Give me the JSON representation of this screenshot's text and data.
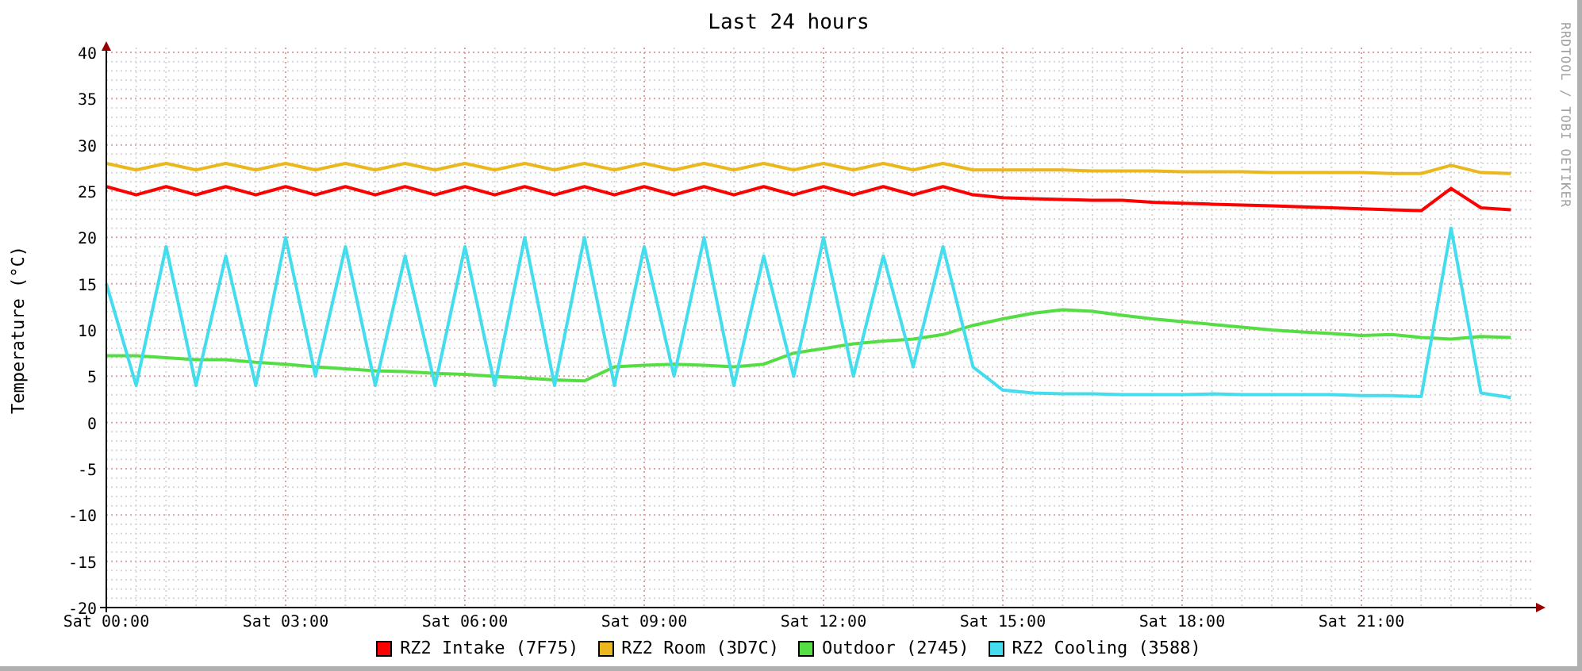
{
  "credit": "RRDTOOL / TOBI OETIKER",
  "chart_data": {
    "type": "line",
    "title": "Last 24 hours",
    "ylabel": "Temperature (°C)",
    "grid": true,
    "ylim": [
      -20,
      40
    ],
    "yticks": [
      -20,
      -15,
      -10,
      -5,
      0,
      5,
      10,
      15,
      20,
      25,
      30,
      35,
      40
    ],
    "categories": [
      "Sat 00:00",
      null,
      null,
      null,
      null,
      null,
      "Sat 03:00",
      null,
      null,
      null,
      null,
      null,
      "Sat 06:00",
      null,
      null,
      null,
      null,
      null,
      "Sat 09:00",
      null,
      null,
      null,
      null,
      null,
      "Sat 12:00",
      null,
      null,
      null,
      null,
      null,
      "Sat 15:00",
      null,
      null,
      null,
      null,
      null,
      "Sat 18:00",
      null,
      null,
      null,
      null,
      null,
      "Sat 21:00",
      null,
      null,
      null,
      null,
      null
    ],
    "series": [
      {
        "name": "RZ2 Intake (7F75)",
        "color": "#ff0000",
        "values": [
          25.5,
          24.6,
          25.5,
          24.6,
          25.5,
          24.6,
          25.5,
          24.6,
          25.5,
          24.6,
          25.5,
          24.6,
          25.5,
          24.6,
          25.5,
          24.6,
          25.5,
          24.6,
          25.5,
          24.6,
          25.5,
          24.6,
          25.5,
          24.6,
          25.5,
          24.6,
          25.5,
          24.6,
          25.5,
          24.6,
          24.3,
          24.2,
          24.1,
          24.0,
          24.0,
          23.8,
          23.7,
          23.6,
          23.5,
          23.4,
          23.3,
          23.2,
          23.1,
          23.0,
          22.9,
          25.3,
          23.2,
          23.0
        ]
      },
      {
        "name": "RZ2 Room (3D7C)",
        "color": "#eab71c",
        "values": [
          28.0,
          27.3,
          28.0,
          27.3,
          28.0,
          27.3,
          28.0,
          27.3,
          28.0,
          27.3,
          28.0,
          27.3,
          28.0,
          27.3,
          28.0,
          27.3,
          28.0,
          27.3,
          28.0,
          27.3,
          28.0,
          27.3,
          28.0,
          27.3,
          28.0,
          27.3,
          28.0,
          27.3,
          28.0,
          27.3,
          27.3,
          27.3,
          27.3,
          27.2,
          27.2,
          27.2,
          27.1,
          27.1,
          27.1,
          27.0,
          27.0,
          27.0,
          27.0,
          26.9,
          26.9,
          27.8,
          27.0,
          26.9
        ]
      },
      {
        "name": "Outdoor (2745)",
        "color": "#55dd44",
        "values": [
          7.2,
          7.2,
          7.0,
          6.8,
          6.8,
          6.5,
          6.3,
          6.0,
          5.8,
          5.6,
          5.5,
          5.3,
          5.2,
          5.0,
          4.8,
          4.6,
          4.5,
          6.0,
          6.2,
          6.3,
          6.2,
          6.0,
          6.3,
          7.5,
          8.0,
          8.5,
          8.8,
          9.0,
          9.5,
          10.5,
          11.2,
          11.8,
          12.2,
          12.0,
          11.6,
          11.2,
          10.9,
          10.6,
          10.3,
          10.0,
          9.8,
          9.6,
          9.4,
          9.5,
          9.2,
          9.0,
          9.3,
          9.2
        ]
      },
      {
        "name": "RZ2 Cooling (3588)",
        "color": "#44ddee",
        "values": [
          15,
          4,
          19,
          4,
          18,
          4,
          20,
          5,
          19,
          4,
          18,
          4,
          19,
          4,
          20,
          4,
          20,
          4,
          19,
          5,
          20,
          4,
          18,
          5,
          20,
          5,
          18,
          6,
          19,
          6,
          3.5,
          3.2,
          3.1,
          3.1,
          3.0,
          3.0,
          3.0,
          3.1,
          3.0,
          3.0,
          3.0,
          3.0,
          2.9,
          2.9,
          2.8,
          21,
          3.2,
          2.7
        ]
      }
    ]
  }
}
